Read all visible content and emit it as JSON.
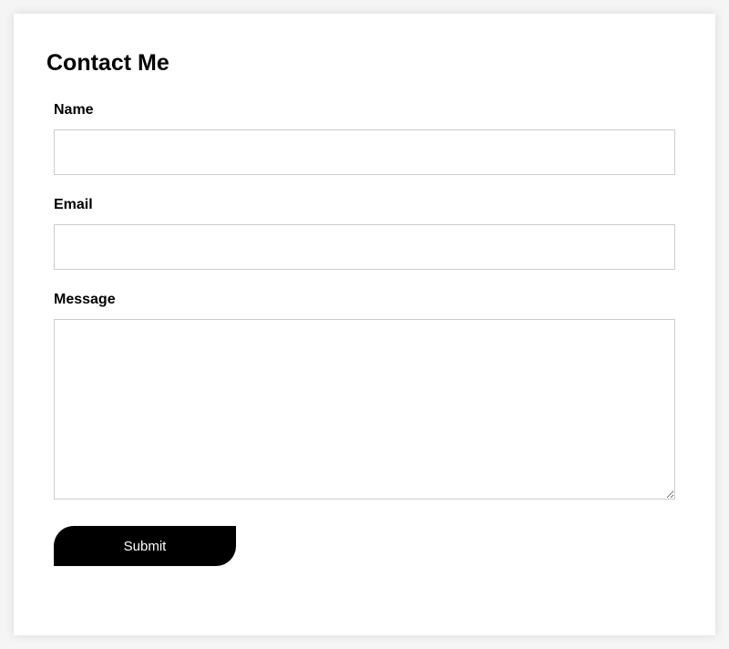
{
  "form": {
    "title": "Contact Me",
    "name": {
      "label": "Name",
      "value": ""
    },
    "email": {
      "label": "Email",
      "value": ""
    },
    "message": {
      "label": "Message",
      "value": ""
    },
    "submit_label": "Submit"
  }
}
